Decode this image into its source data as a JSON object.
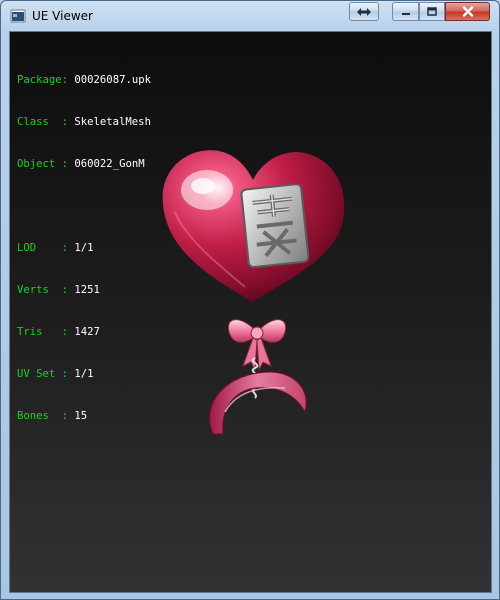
{
  "window": {
    "title": "UE Viewer"
  },
  "colors": {
    "label": "#19d119",
    "value": "#ffffff",
    "viewport_top": "#0d0d0d",
    "viewport_bottom": "#323232"
  },
  "info": {
    "object_rows": [
      {
        "key": "Package",
        "value": "00026087.upk"
      },
      {
        "key": "Class",
        "value": "SkeletalMesh"
      },
      {
        "key": "Object",
        "value": "060022_GonM"
      }
    ],
    "mesh_rows": [
      {
        "key": "LOD",
        "value": "1/1"
      },
      {
        "key": "Verts",
        "value": "1251"
      },
      {
        "key": "Tris",
        "value": "1427"
      },
      {
        "key": "UV Set",
        "value": "1/1"
      },
      {
        "key": "Bones",
        "value": "15"
      }
    ]
  },
  "model": {
    "description_icon": "heart-balloon-icon",
    "emblem_text": "恶魔"
  }
}
